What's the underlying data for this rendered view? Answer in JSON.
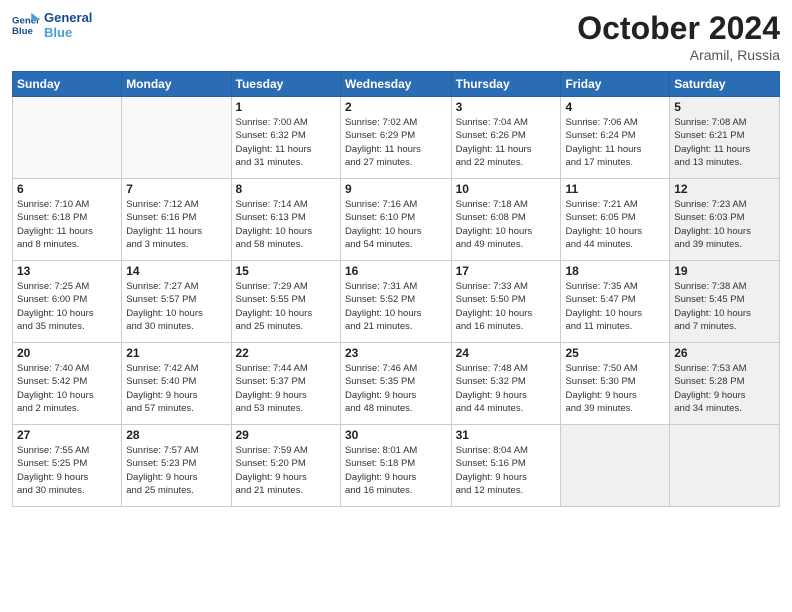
{
  "header": {
    "logo_line1": "General",
    "logo_line2": "Blue",
    "month_title": "October 2024",
    "location": "Aramil, Russia"
  },
  "weekdays": [
    "Sunday",
    "Monday",
    "Tuesday",
    "Wednesday",
    "Thursday",
    "Friday",
    "Saturday"
  ],
  "weeks": [
    [
      {
        "day": "",
        "detail": ""
      },
      {
        "day": "",
        "detail": ""
      },
      {
        "day": "1",
        "detail": "Sunrise: 7:00 AM\nSunset: 6:32 PM\nDaylight: 11 hours\nand 31 minutes."
      },
      {
        "day": "2",
        "detail": "Sunrise: 7:02 AM\nSunset: 6:29 PM\nDaylight: 11 hours\nand 27 minutes."
      },
      {
        "day": "3",
        "detail": "Sunrise: 7:04 AM\nSunset: 6:26 PM\nDaylight: 11 hours\nand 22 minutes."
      },
      {
        "day": "4",
        "detail": "Sunrise: 7:06 AM\nSunset: 6:24 PM\nDaylight: 11 hours\nand 17 minutes."
      },
      {
        "day": "5",
        "detail": "Sunrise: 7:08 AM\nSunset: 6:21 PM\nDaylight: 11 hours\nand 13 minutes."
      }
    ],
    [
      {
        "day": "6",
        "detail": "Sunrise: 7:10 AM\nSunset: 6:18 PM\nDaylight: 11 hours\nand 8 minutes."
      },
      {
        "day": "7",
        "detail": "Sunrise: 7:12 AM\nSunset: 6:16 PM\nDaylight: 11 hours\nand 3 minutes."
      },
      {
        "day": "8",
        "detail": "Sunrise: 7:14 AM\nSunset: 6:13 PM\nDaylight: 10 hours\nand 58 minutes."
      },
      {
        "day": "9",
        "detail": "Sunrise: 7:16 AM\nSunset: 6:10 PM\nDaylight: 10 hours\nand 54 minutes."
      },
      {
        "day": "10",
        "detail": "Sunrise: 7:18 AM\nSunset: 6:08 PM\nDaylight: 10 hours\nand 49 minutes."
      },
      {
        "day": "11",
        "detail": "Sunrise: 7:21 AM\nSunset: 6:05 PM\nDaylight: 10 hours\nand 44 minutes."
      },
      {
        "day": "12",
        "detail": "Sunrise: 7:23 AM\nSunset: 6:03 PM\nDaylight: 10 hours\nand 39 minutes."
      }
    ],
    [
      {
        "day": "13",
        "detail": "Sunrise: 7:25 AM\nSunset: 6:00 PM\nDaylight: 10 hours\nand 35 minutes."
      },
      {
        "day": "14",
        "detail": "Sunrise: 7:27 AM\nSunset: 5:57 PM\nDaylight: 10 hours\nand 30 minutes."
      },
      {
        "day": "15",
        "detail": "Sunrise: 7:29 AM\nSunset: 5:55 PM\nDaylight: 10 hours\nand 25 minutes."
      },
      {
        "day": "16",
        "detail": "Sunrise: 7:31 AM\nSunset: 5:52 PM\nDaylight: 10 hours\nand 21 minutes."
      },
      {
        "day": "17",
        "detail": "Sunrise: 7:33 AM\nSunset: 5:50 PM\nDaylight: 10 hours\nand 16 minutes."
      },
      {
        "day": "18",
        "detail": "Sunrise: 7:35 AM\nSunset: 5:47 PM\nDaylight: 10 hours\nand 11 minutes."
      },
      {
        "day": "19",
        "detail": "Sunrise: 7:38 AM\nSunset: 5:45 PM\nDaylight: 10 hours\nand 7 minutes."
      }
    ],
    [
      {
        "day": "20",
        "detail": "Sunrise: 7:40 AM\nSunset: 5:42 PM\nDaylight: 10 hours\nand 2 minutes."
      },
      {
        "day": "21",
        "detail": "Sunrise: 7:42 AM\nSunset: 5:40 PM\nDaylight: 9 hours\nand 57 minutes."
      },
      {
        "day": "22",
        "detail": "Sunrise: 7:44 AM\nSunset: 5:37 PM\nDaylight: 9 hours\nand 53 minutes."
      },
      {
        "day": "23",
        "detail": "Sunrise: 7:46 AM\nSunset: 5:35 PM\nDaylight: 9 hours\nand 48 minutes."
      },
      {
        "day": "24",
        "detail": "Sunrise: 7:48 AM\nSunset: 5:32 PM\nDaylight: 9 hours\nand 44 minutes."
      },
      {
        "day": "25",
        "detail": "Sunrise: 7:50 AM\nSunset: 5:30 PM\nDaylight: 9 hours\nand 39 minutes."
      },
      {
        "day": "26",
        "detail": "Sunrise: 7:53 AM\nSunset: 5:28 PM\nDaylight: 9 hours\nand 34 minutes."
      }
    ],
    [
      {
        "day": "27",
        "detail": "Sunrise: 7:55 AM\nSunset: 5:25 PM\nDaylight: 9 hours\nand 30 minutes."
      },
      {
        "day": "28",
        "detail": "Sunrise: 7:57 AM\nSunset: 5:23 PM\nDaylight: 9 hours\nand 25 minutes."
      },
      {
        "day": "29",
        "detail": "Sunrise: 7:59 AM\nSunset: 5:20 PM\nDaylight: 9 hours\nand 21 minutes."
      },
      {
        "day": "30",
        "detail": "Sunrise: 8:01 AM\nSunset: 5:18 PM\nDaylight: 9 hours\nand 16 minutes."
      },
      {
        "day": "31",
        "detail": "Sunrise: 8:04 AM\nSunset: 5:16 PM\nDaylight: 9 hours\nand 12 minutes."
      },
      {
        "day": "",
        "detail": ""
      },
      {
        "day": "",
        "detail": ""
      }
    ]
  ]
}
